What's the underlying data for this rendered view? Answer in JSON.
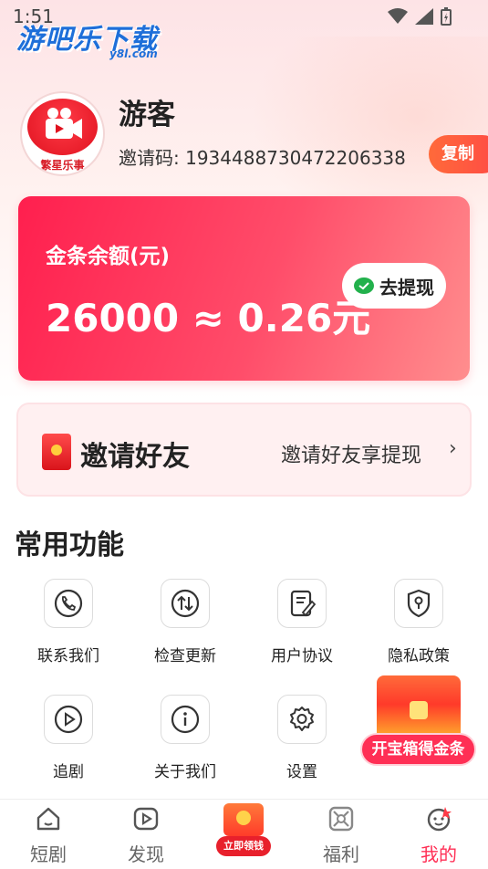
{
  "status_bar": {
    "time": "1:51"
  },
  "watermark": {
    "text": "游吧乐下载",
    "sub": "y8l.com"
  },
  "profile": {
    "avatar_caption": "繁星乐事",
    "username": "游客",
    "invite_code": "邀请码: 1934488730472206338",
    "copy_label": "复制"
  },
  "balance": {
    "label": "金条余额(元)",
    "value": "26000 ≈ 0.26元",
    "withdraw_label": "去提现"
  },
  "invite": {
    "title": "邀请好友",
    "subtitle": "邀请好友享提现",
    "chevron": "›"
  },
  "functions": {
    "title": "常用功能",
    "items": [
      {
        "label": "联系我们",
        "icon": "phone-icon"
      },
      {
        "label": "检查更新",
        "icon": "update-icon"
      },
      {
        "label": "用户协议",
        "icon": "agreement-icon"
      },
      {
        "label": "隐私政策",
        "icon": "privacy-shield-icon"
      },
      {
        "label": "追剧",
        "icon": "play-icon"
      },
      {
        "label": "关于我们",
        "icon": "info-icon"
      },
      {
        "label": "设置",
        "icon": "gear-icon"
      }
    ]
  },
  "treasure": {
    "label": "开宝箱得金条"
  },
  "bottom_nav": {
    "items": [
      {
        "label": "短剧",
        "icon": "home-icon",
        "active": false
      },
      {
        "label": "发现",
        "icon": "play-square-icon",
        "active": false
      },
      {
        "label": "福利",
        "icon": "gift-grid-icon",
        "active": false
      },
      {
        "label": "我的",
        "icon": "profile-face-icon",
        "active": true
      }
    ],
    "reward_label": "立即领钱"
  },
  "colors": {
    "accent": "#ff2f55",
    "card_start": "#ff1f4e",
    "card_end": "#ff8e8e",
    "copy_button": "#ff5a40"
  }
}
